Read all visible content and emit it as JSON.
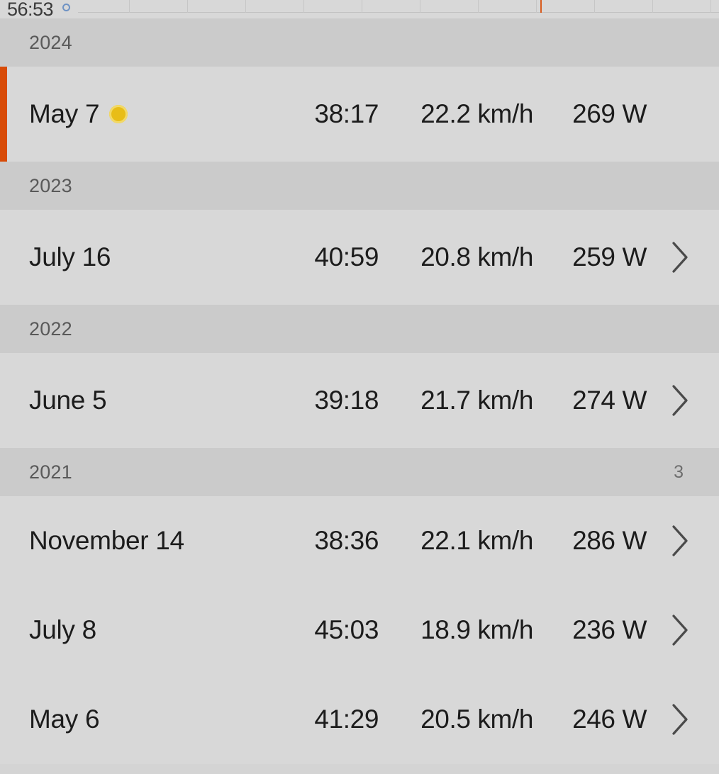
{
  "chart_strip": {
    "value_label": "56:53",
    "marker_icon": "chart-point-marker",
    "gridline_positions": [
      182,
      264,
      346,
      428,
      510,
      592,
      674,
      756,
      838,
      920,
      1002
    ],
    "highlight_tick_x": 762,
    "highlight_color": "#d85b1e",
    "point_color": "#6f93c4"
  },
  "colors": {
    "section_header_bg": "#cbcbcb",
    "row_bg": "#d8d8d8",
    "accent_bar": "#d84b07",
    "pr_badge": "#e8bd17",
    "text_primary": "#1c1c1c",
    "text_muted": "#595959"
  },
  "sections": [
    {
      "year": "2024",
      "count": "",
      "rows": [
        {
          "date": "May 7",
          "time": "38:17",
          "speed": "22.2 km/h",
          "power": "269 W",
          "has_pr_badge": true,
          "has_accent_bar": true,
          "has_chevron": false
        }
      ]
    },
    {
      "year": "2023",
      "count": "",
      "rows": [
        {
          "date": "July 16",
          "time": "40:59",
          "speed": "20.8 km/h",
          "power": "259 W",
          "has_pr_badge": false,
          "has_accent_bar": false,
          "has_chevron": true
        }
      ]
    },
    {
      "year": "2022",
      "count": "",
      "rows": [
        {
          "date": "June 5",
          "time": "39:18",
          "speed": "21.7 km/h",
          "power": "274 W",
          "has_pr_badge": false,
          "has_accent_bar": false,
          "has_chevron": true
        }
      ]
    },
    {
      "year": "2021",
      "count": "3",
      "rows": [
        {
          "date": "November 14",
          "time": "38:36",
          "speed": "22.1 km/h",
          "power": "286 W",
          "has_pr_badge": false,
          "has_accent_bar": false,
          "has_chevron": true
        },
        {
          "date": "July 8",
          "time": "45:03",
          "speed": "18.9 km/h",
          "power": "236 W",
          "has_pr_badge": false,
          "has_accent_bar": false,
          "has_chevron": true
        },
        {
          "date": "May 6",
          "time": "41:29",
          "speed": "20.5 km/h",
          "power": "246 W",
          "has_pr_badge": false,
          "has_accent_bar": false,
          "has_chevron": true
        }
      ]
    }
  ]
}
